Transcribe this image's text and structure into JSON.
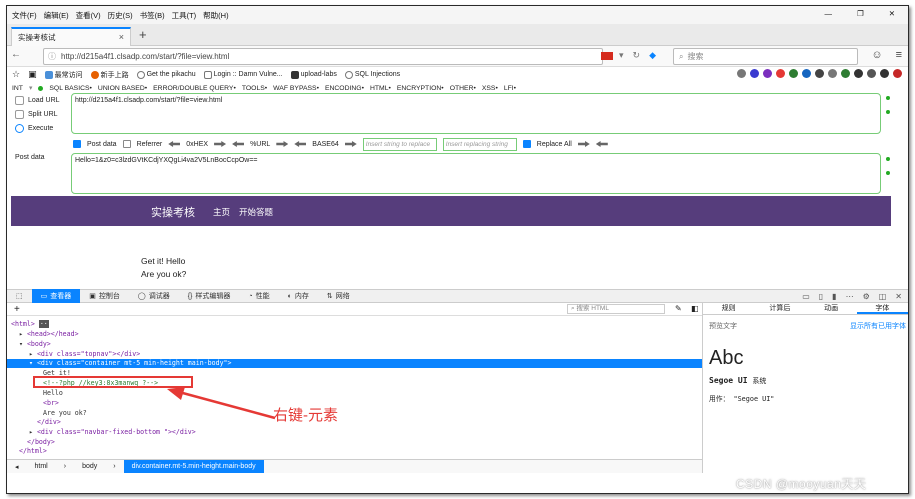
{
  "menu": [
    "文件(F)",
    "编辑(E)",
    "查看(V)",
    "历史(S)",
    "书签(B)",
    "工具(T)",
    "帮助(H)"
  ],
  "tab": {
    "title": "实操考核试"
  },
  "url": "http://d215a4f1.clsadp.com/start/?file=view.html",
  "search_placeholder": "搜索",
  "bookmarks": [
    "最常访问",
    "新手上路",
    "Get the pikachu",
    "Login :: Damn Vulne...",
    "upload-labs",
    "SQL Injections"
  ],
  "hackbar": {
    "menu": [
      "INT",
      "SQL BASICS•",
      "UNION BASED•",
      "ERROR/DOUBLE QUERY•",
      "TOOLS•",
      "WAF BYPASS•",
      "ENCODING•",
      "HTML•",
      "ENCRYPTION•",
      "OTHER•",
      "XSS•",
      "LFI•"
    ],
    "load_url": "Load URL",
    "split_url": "Split URL",
    "execute": "Execute",
    "url_value": "http://d215a4f1.clsadp.com/start/?file=view.html",
    "post_label": "Post data",
    "post_value": "Hello=1&z0=c3lzdGVtKCdjYXQgLi4va2V5LnBocCcpOw==",
    "opt_post": "Post data",
    "opt_referrer": "Referrer",
    "opt_hex": "0xHEX",
    "opt_url": "%URL",
    "opt_base64": "BASE64",
    "insert_placeholder": "Insert string to replace",
    "replacing_placeholder": "Insert replacing string",
    "replace_all": "Replace All"
  },
  "page": {
    "brand": "实操考核",
    "nav1": "主页",
    "nav2": "开始答题",
    "line1": "Get it! Hello",
    "line2": "Are you ok?"
  },
  "devtools": {
    "tabs": [
      "查看器",
      "控制台",
      "调试器",
      "样式编辑器",
      "性能",
      "内存",
      "网络"
    ],
    "search_html": "搜索 HTML",
    "markup": [
      {
        "t": "<html>"
      },
      {
        "t": "<head></head>"
      },
      {
        "t": "<body>"
      },
      {
        "t": "<div class=\"topnav\"></div>"
      },
      {
        "t": "<div class=\"container mt-5 min-height main-body\">"
      },
      {
        "t": "Get it!"
      },
      {
        "t": "<!--?php //key3:8x3manwq ?-->"
      },
      {
        "t": "Hello"
      },
      {
        "t": "<br>"
      },
      {
        "t": "Are you ok?"
      },
      {
        "t": "</div>"
      },
      {
        "t": "<div class=\"navbar-fixed-bottom \"></div>"
      },
      {
        "t": "</body>"
      },
      {
        "t": "</html>"
      }
    ],
    "side_tabs": [
      "规则",
      "计算后",
      "动画",
      "字体"
    ],
    "preview_label": "预览文字",
    "show_all": "显示所有已用字体",
    "font_sample": "Abc",
    "font_name": "Segoe UI",
    "font_sys": "系统",
    "font_used": "用作： \"Segoe UI\"",
    "crumbs": [
      "html",
      "body",
      "div.container.mt-5.min-height.main-body"
    ]
  },
  "annotation": "右键-元素",
  "watermark": "CSDN @mooyuan天天",
  "colors": {
    "accent": "#0a84ff",
    "banner": "#563d7c",
    "annot": "#e53935",
    "hackbar_green": "#7c7"
  }
}
